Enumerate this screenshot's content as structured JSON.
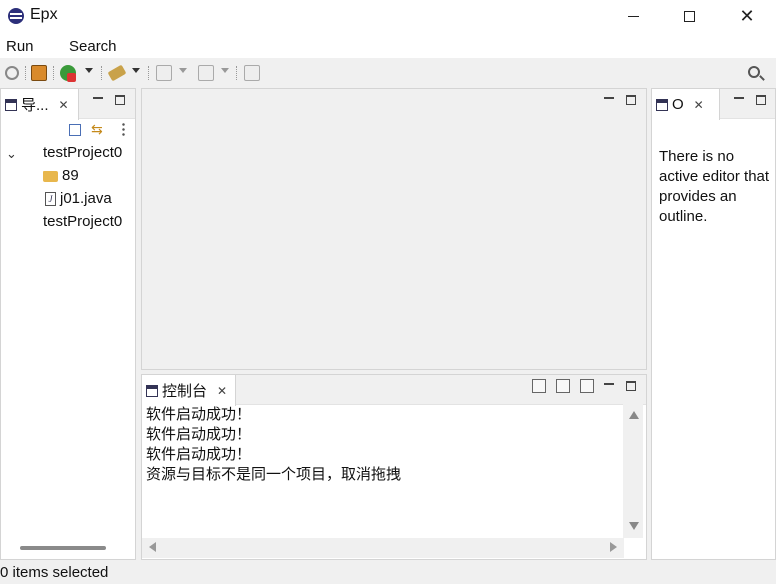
{
  "window": {
    "title": "Epx",
    "minimize_icon": "minimize-icon",
    "maximize_icon": "maximize-icon",
    "close_icon": "close-icon",
    "close_glyph": "✕"
  },
  "menu": {
    "items": [
      {
        "label": "Run"
      },
      {
        "label": "Search"
      }
    ]
  },
  "toolbar": {
    "icons": [
      "refresh-icon",
      "build-icon",
      "run-icon",
      "external-tools-icon",
      "next-annotation-icon",
      "previous-annotation-icon",
      "back-icon"
    ],
    "search_icon": "search-icon"
  },
  "navigator": {
    "tab_label": "导...",
    "items": [
      {
        "label": "testProject0",
        "expanded": true
      },
      {
        "label": "89",
        "icon": "folder-icon"
      },
      {
        "label": "j01.java",
        "icon": "java-file-icon"
      },
      {
        "label": "testProject0"
      }
    ],
    "expand_glyph": "⌄",
    "java_glyph": "J"
  },
  "console": {
    "tab_label": "控制台",
    "lines": [
      "软件启动成功！",
      "软件启动成功！",
      "软件启动成功！",
      "资源与目标不是同一个项目，取消拖拽"
    ]
  },
  "outline": {
    "tab_label": "O",
    "message": "There is no active editor that provides an outline."
  },
  "status_bar": {
    "text": "0 items selected"
  },
  "colors": {
    "app_icon": "#2c2f7a",
    "folder": "#e8b74d",
    "panel_bg": "#ffffff",
    "chrome_bg": "#f0f0f0"
  }
}
